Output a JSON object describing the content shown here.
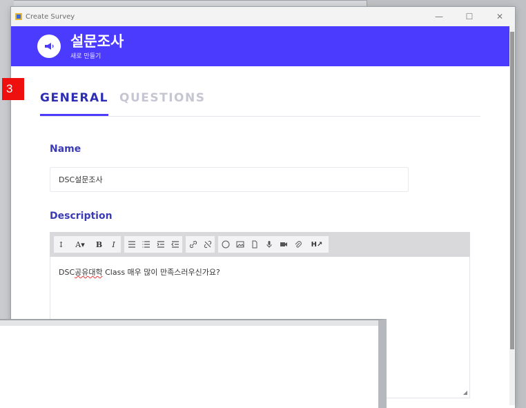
{
  "window": {
    "title": "Create Survey",
    "minimize_icon": "—",
    "maximize_icon": "☐",
    "close_icon": "✕"
  },
  "header": {
    "title": "설문조사",
    "subtitle": "새로 만들기",
    "icon": "megaphone-icon",
    "color": "#4b3bff"
  },
  "step_badge": "3",
  "tabs": [
    {
      "label": "GENERAL",
      "active": true
    },
    {
      "label": "QUESTIONS",
      "active": false
    }
  ],
  "form": {
    "name_label": "Name",
    "name_value": "DSC설문조사",
    "description_label": "Description",
    "description_prefix": "DSC",
    "description_underlined": "공유대학",
    "description_suffix": " Class 매우 많이 만족스러우신가요?"
  },
  "toolbar": {
    "font_size": "↕",
    "font_color": "A▾",
    "bold": "B",
    "italic": "I",
    "heading": "H↗"
  }
}
